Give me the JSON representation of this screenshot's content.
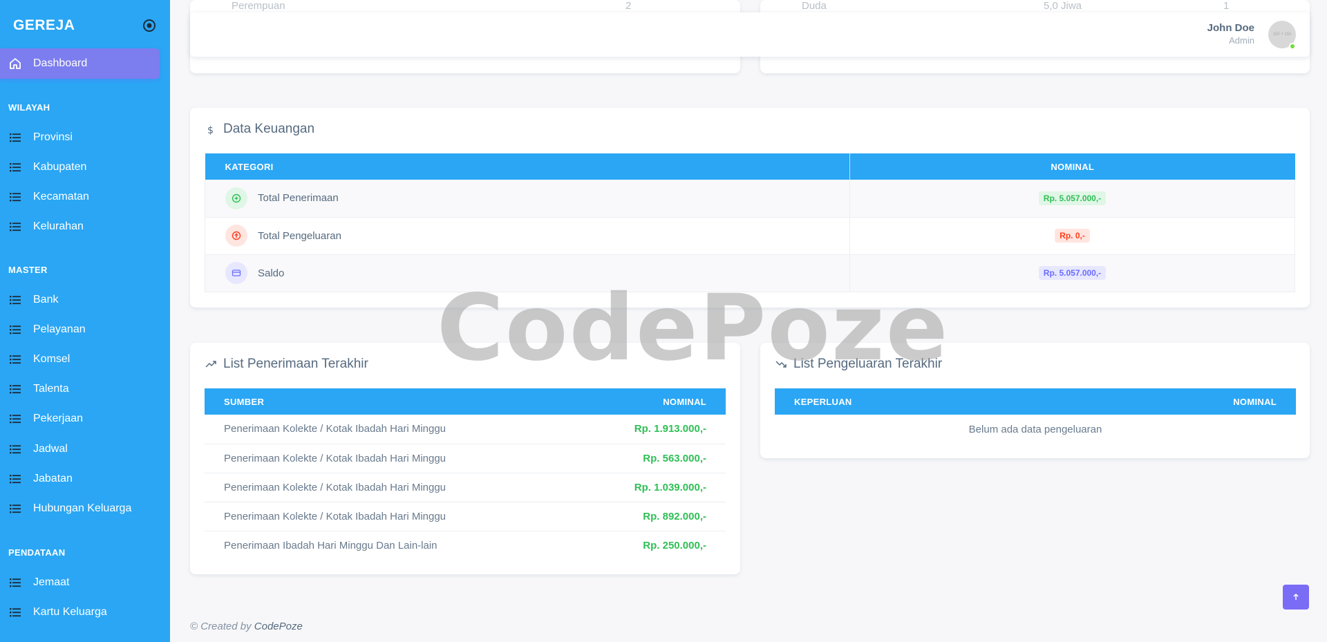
{
  "sidebar": {
    "brand": "GEREJA",
    "active_item": "Dashboard",
    "sections": [
      {
        "header": "WILAYAH",
        "items": [
          "Provinsi",
          "Kabupaten",
          "Kecamatan",
          "Kelurahan"
        ]
      },
      {
        "header": "MASTER",
        "items": [
          "Bank",
          "Pelayanan",
          "Komsel",
          "Talenta",
          "Pekerjaan",
          "Jadwal",
          "Jabatan",
          "Hubungan Keluarga"
        ]
      },
      {
        "header": "PENDATAAN",
        "items": [
          "Jemaat",
          "Kartu Keluarga"
        ]
      }
    ]
  },
  "topbar": {
    "user_name": "John Doe",
    "user_role": "Admin",
    "avatar_text": "150 × 150",
    "behind_left": "Perempuan",
    "behind_left_num": "2",
    "behind_right": "Duda",
    "behind_right_num": "1",
    "behind_right_val": "5,0 Jiwa"
  },
  "keuangan": {
    "title": "Data Keuangan",
    "col_kategori": "KATEGORI",
    "col_nominal": "NOMINAL",
    "rows": [
      {
        "label": "Total Penerimaan",
        "value": "Rp. 5.057.000,-"
      },
      {
        "label": "Total Pengeluaran",
        "value": "Rp. 0,-"
      },
      {
        "label": "Saldo",
        "value": "Rp. 5.057.000,-"
      }
    ]
  },
  "penerimaan": {
    "title": "List Penerimaan Terakhir",
    "col_sumber": "SUMBER",
    "col_nominal": "NOMINAL",
    "rows": [
      {
        "sumber": "Penerimaan Kolekte / Kotak Ibadah Hari Minggu",
        "nominal": "Rp. 1.913.000,-"
      },
      {
        "sumber": "Penerimaan Kolekte / Kotak Ibadah Hari Minggu",
        "nominal": "Rp. 563.000,-"
      },
      {
        "sumber": "Penerimaan Kolekte / Kotak Ibadah Hari Minggu",
        "nominal": "Rp. 1.039.000,-"
      },
      {
        "sumber": "Penerimaan Kolekte / Kotak Ibadah Hari Minggu",
        "nominal": "Rp. 892.000,-"
      },
      {
        "sumber": "Penerimaan Ibadah Hari Minggu Dan Lain-lain",
        "nominal": "Rp. 250.000,-"
      }
    ]
  },
  "pengeluaran": {
    "title": "List Pengeluaran Terakhir",
    "col_keperluan": "KEPERLUAN",
    "col_nominal": "NOMINAL",
    "empty": "Belum ada data pengeluaran"
  },
  "watermark": "CodePoze",
  "footer": {
    "prefix": "© Created by",
    "brand": "CodePoze"
  },
  "colors": {
    "sidebar": "#2aa6f4",
    "active": "#7c7dee",
    "success": "#2fbf55",
    "danger": "#ff3e1d",
    "info": "#696cff"
  }
}
